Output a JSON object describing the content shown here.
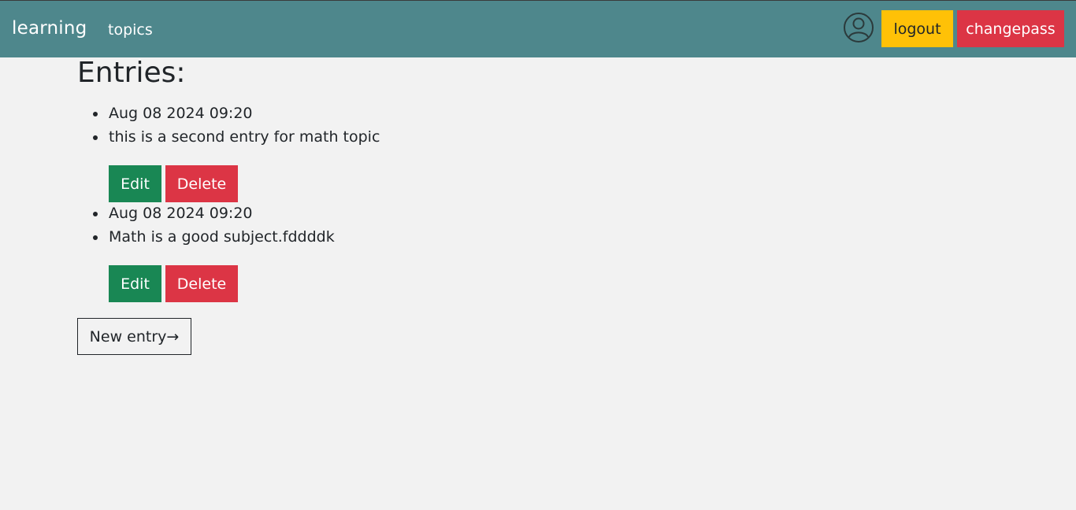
{
  "nav": {
    "brand": "learning",
    "topics_link": "topics",
    "avatar_icon": "user-circle-icon",
    "logout_label": "logout",
    "changepass_label": "changepass"
  },
  "main": {
    "heading": "Entries:",
    "entries": [
      {
        "date": "Aug 08 2024 09:20",
        "text": "this is a second entry for math topic",
        "edit_label": "Edit",
        "delete_label": "Delete"
      },
      {
        "date": "Aug 08 2024 09:20",
        "text": "Math is a good subject.fddddk",
        "edit_label": "Edit",
        "delete_label": "Delete"
      }
    ],
    "new_entry_label": "New entry→"
  },
  "colors": {
    "navbar": "#4e878c",
    "background": "#f2f2f2",
    "warning": "#ffc107",
    "danger": "#dc3545",
    "success": "#198754"
  }
}
